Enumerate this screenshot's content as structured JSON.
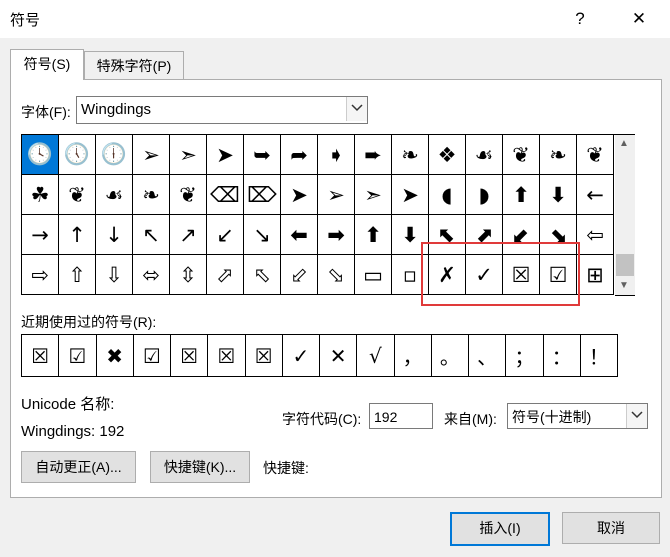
{
  "window": {
    "title": "符号",
    "help_label": "?",
    "close_label": "✕"
  },
  "tabs": [
    {
      "label": "符号(S)"
    },
    {
      "label": "特殊字符(P)"
    }
  ],
  "font": {
    "label": "字体(F):",
    "value": "Wingdings"
  },
  "symbols": [
    "🕓",
    "🕔",
    "🕕",
    "➢",
    "➣",
    "➤",
    "➥",
    "➦",
    "➧",
    "➨",
    "❧",
    "❖",
    "☙",
    "❦",
    "❧",
    "❦",
    "☘",
    "❦",
    "☙",
    "❧",
    "❦",
    "⌫",
    "⌦",
    "➤",
    "➢",
    "➣",
    "➤",
    "◖",
    "◗",
    "⬆",
    "⬇",
    "←",
    "→",
    "↑",
    "↓",
    "↖",
    "↗",
    "↙",
    "↘",
    "⬅",
    "➡",
    "⬆",
    "⬇",
    "⬉",
    "⬈",
    "⬋",
    "⬊",
    "⇦",
    "⇨",
    "⇧",
    "⇩",
    "⬄",
    "⇳",
    "⬀",
    "⬁",
    "⬃",
    "⬂",
    "▭",
    "▫",
    "✗",
    "✓",
    "☒",
    "☑",
    "⊞"
  ],
  "recent": {
    "label": "近期使用过的符号(R):",
    "items": [
      "☒",
      "☑",
      "✖",
      "☑",
      "☒",
      "☒",
      "☒",
      "✓",
      "✕",
      "√",
      "，",
      "。",
      "、",
      "；",
      "：",
      "！"
    ]
  },
  "unicode": {
    "name_label": "Unicode 名称:",
    "name_value": "Wingdings: 192"
  },
  "char_code": {
    "label": "字符代码(C):",
    "value": "192"
  },
  "from": {
    "label": "来自(M):",
    "value": "符号(十进制)"
  },
  "buttons": {
    "autocorrect": "自动更正(A)...",
    "shortcut_key": "快捷键(K)...",
    "shortcut_label": "快捷键:",
    "insert": "插入(I)",
    "cancel": "取消"
  }
}
